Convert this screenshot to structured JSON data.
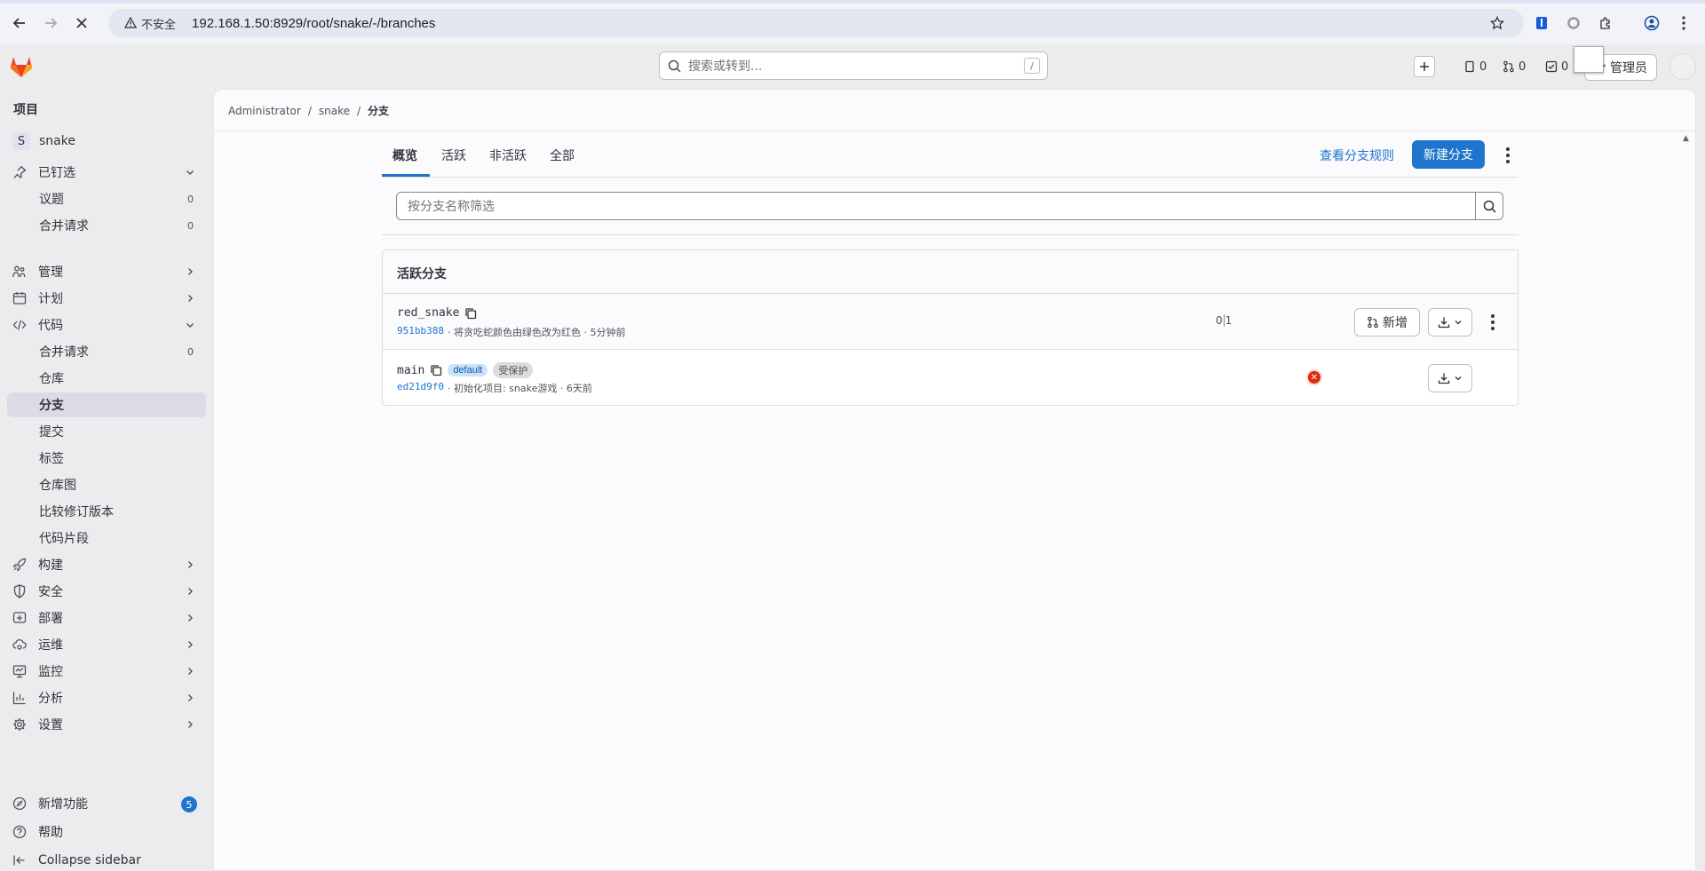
{
  "browser": {
    "security_label": "不安全",
    "url_host": "192.168.1.50",
    "url_rest": ":8929/root/snake/-/branches"
  },
  "header": {
    "search_placeholder": "搜索或转到...",
    "search_shortcut": "/",
    "issues_count": "0",
    "mr_count": "0",
    "todo_count": "0",
    "admin_label": "管理员"
  },
  "sidebar": {
    "heading": "项目",
    "project_initial": "S",
    "project_name": "snake",
    "pinned": "已钉选",
    "pinned_items": [
      {
        "label": "议题",
        "count": "0"
      },
      {
        "label": "合并请求",
        "count": "0"
      }
    ],
    "manage": "管理",
    "plan": "计划",
    "code": "代码",
    "code_items": [
      {
        "label": "合并请求",
        "count": "0"
      },
      {
        "label": "仓库"
      },
      {
        "label": "分支"
      },
      {
        "label": "提交"
      },
      {
        "label": "标签"
      },
      {
        "label": "仓库图"
      },
      {
        "label": "比较修订版本"
      },
      {
        "label": "代码片段"
      }
    ],
    "build": "构建",
    "secure": "安全",
    "deploy": "部署",
    "operate": "运维",
    "monitor": "监控",
    "analyze": "分析",
    "settings": "设置",
    "whats_new": "新增功能",
    "whats_new_count": "5",
    "help": "帮助",
    "collapse": "Collapse sidebar"
  },
  "breadcrumb": {
    "items": [
      "Administrator",
      "snake",
      "分支"
    ]
  },
  "tabs": [
    "概览",
    "活跃",
    "非活跃",
    "全部"
  ],
  "actions": {
    "rules_link": "查看分支规则",
    "new_branch": "新建分支"
  },
  "filter": {
    "placeholder": "按分支名称筛选"
  },
  "panel": {
    "title": "活跃分支",
    "branches": [
      {
        "name": "red_snake",
        "sha": "951bb388",
        "message": "· 将贪吃蛇颜色由绿色改为红色 · 5分钟前",
        "behind": "0",
        "ahead": "1",
        "mr_label": "新增"
      },
      {
        "name": "main",
        "tags": [
          "default",
          "受保护"
        ],
        "sha": "ed21d9f0",
        "message": "· 初始化项目: snake游戏 · 6天前",
        "pipeline": "failed"
      }
    ]
  },
  "colors": {
    "accent": "#1f75cb",
    "danger": "#dd2b0e",
    "sidebar_active": "#dbdbe6"
  }
}
